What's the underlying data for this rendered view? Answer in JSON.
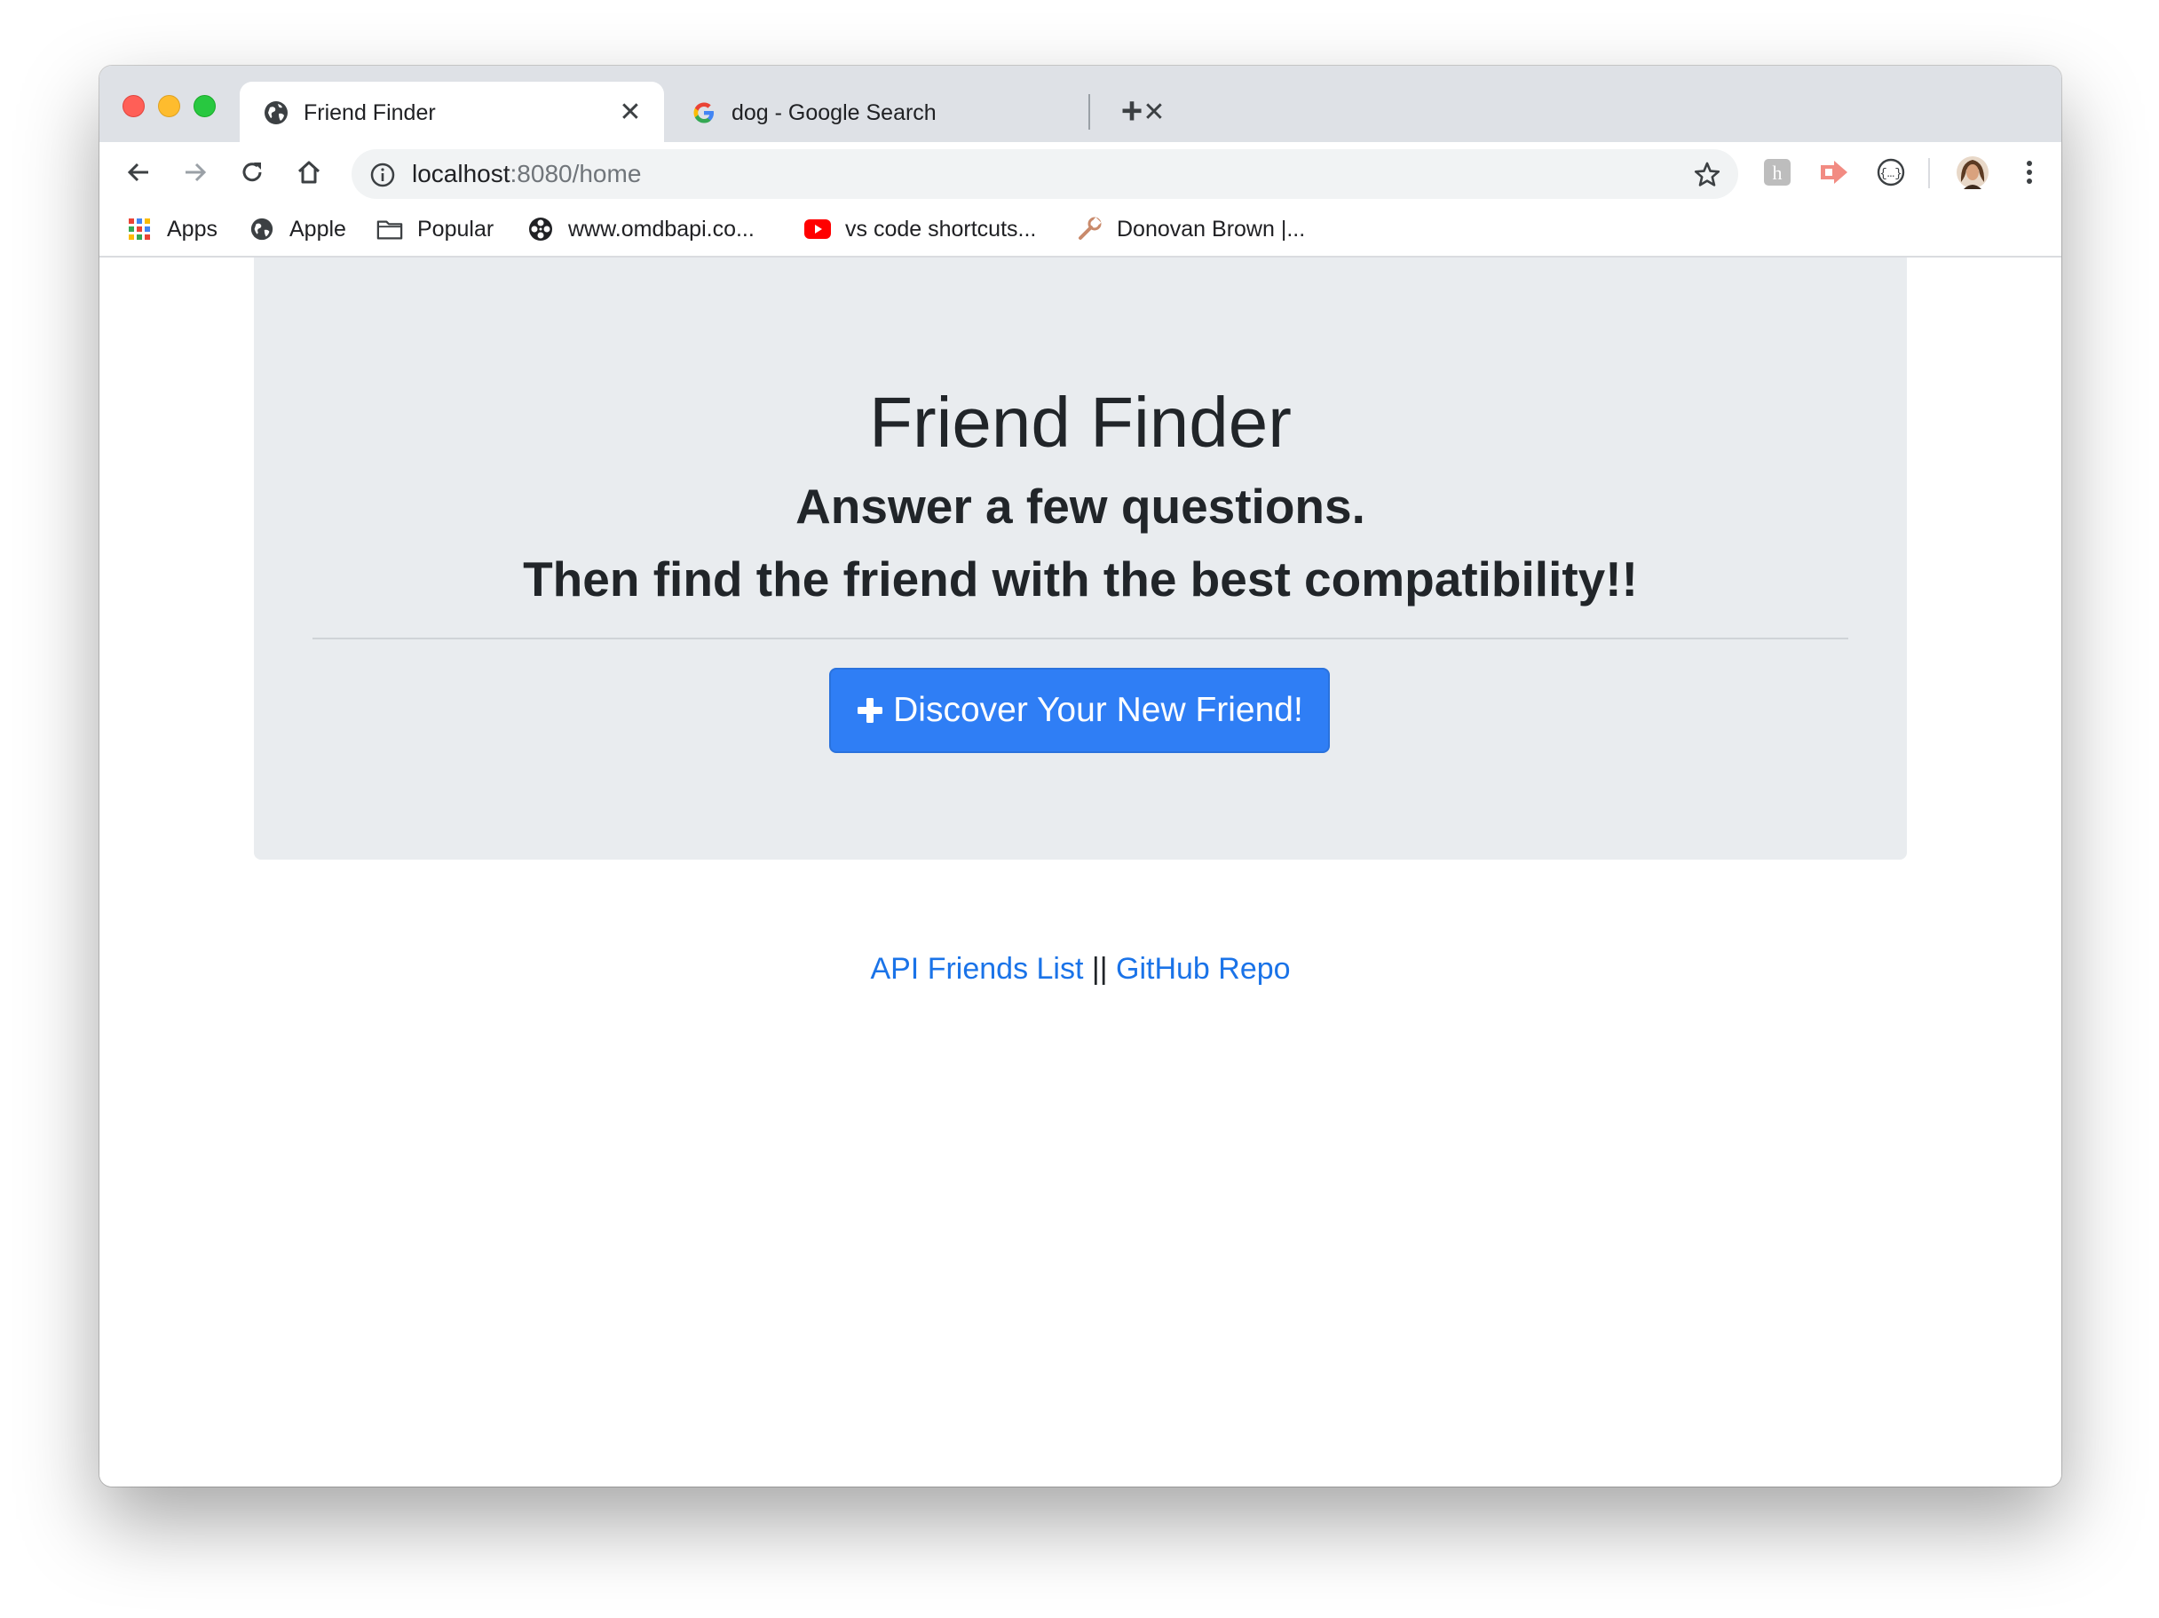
{
  "browser": {
    "tabs": [
      {
        "title": "Friend Finder",
        "icon": "globe-icon",
        "active": true
      },
      {
        "title": "dog - Google Search",
        "icon": "google-icon",
        "active": false
      }
    ],
    "address": {
      "host": "localhost",
      "rest": ":8080/home"
    },
    "bookmarks": [
      {
        "label": "Apps",
        "icon": "apps-grid-icon"
      },
      {
        "label": "Apple",
        "icon": "globe-icon"
      },
      {
        "label": "Popular",
        "icon": "folder-icon"
      },
      {
        "label": "www.omdbapi.co...",
        "icon": "film-reel-icon"
      },
      {
        "label": "vs code shortcuts...",
        "icon": "youtube-icon"
      },
      {
        "label": "Donovan Brown |...",
        "icon": "wrench-icon"
      }
    ]
  },
  "page": {
    "title": "Friend Finder",
    "subtitle_line1": "Answer a few questions.",
    "subtitle_line2": "Then find the friend with the best compatibility!!",
    "cta_label": "Discover Your New Friend!",
    "footer": {
      "link1": "API Friends List",
      "separator": " || ",
      "link2": "GitHub Repo"
    }
  },
  "colors": {
    "jumbotron_bg": "#e9ecef",
    "button_bg": "#2f7ef5",
    "link": "#1a73e8"
  }
}
